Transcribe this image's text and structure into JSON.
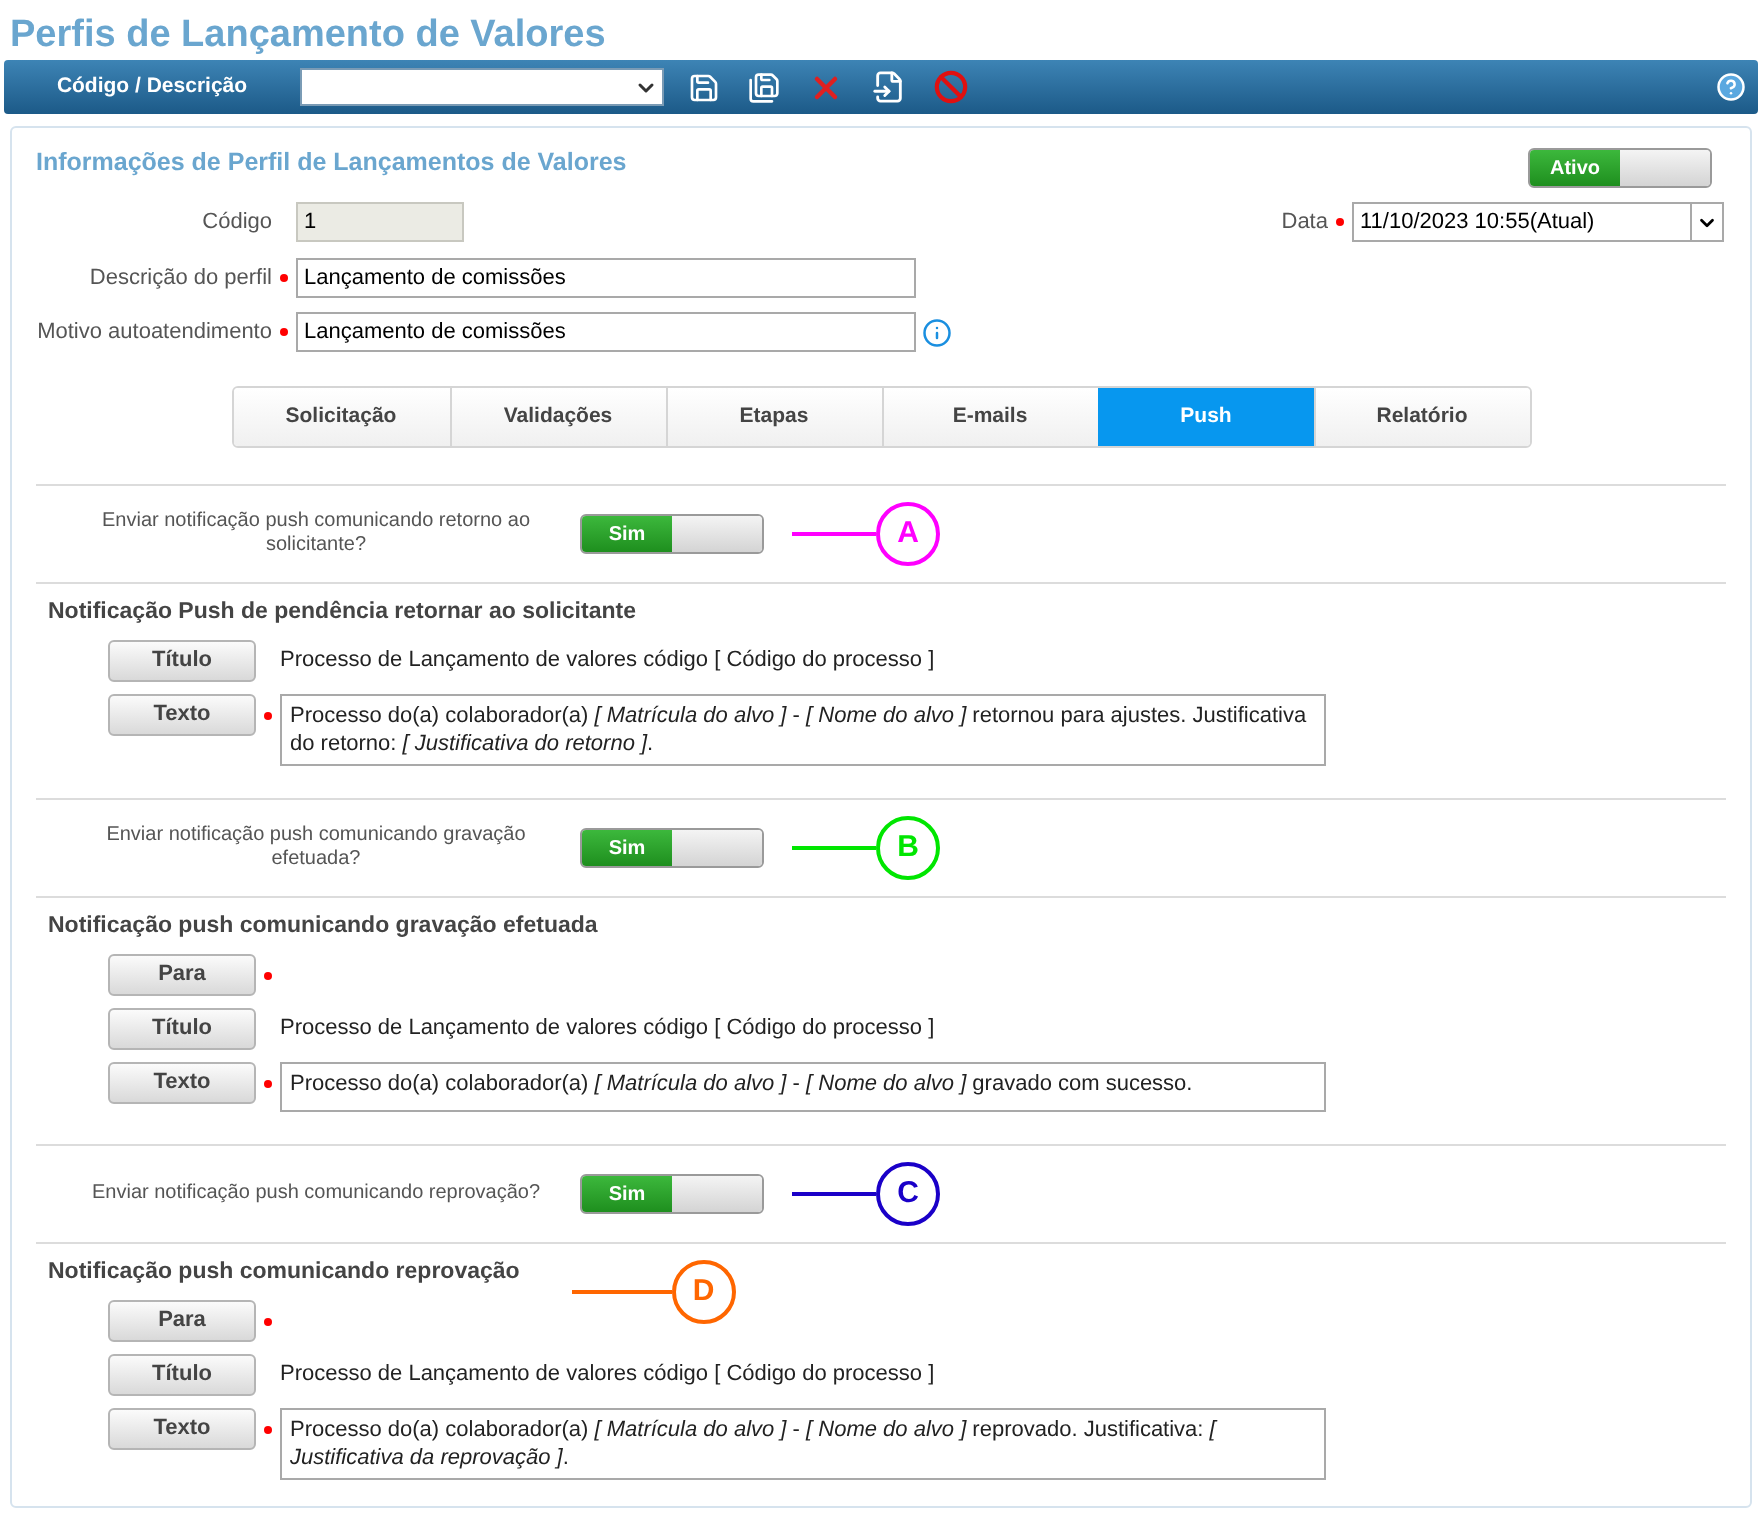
{
  "page_title": "Perfis de Lançamento de Valores",
  "toolbar": {
    "label": "Código / Descrição"
  },
  "panel": {
    "title": "Informações de Perfil de Lançamentos de Valores",
    "status_toggle": {
      "label": "Ativo",
      "on": true
    },
    "fields": {
      "codigo": {
        "label": "Código",
        "value": "1"
      },
      "data": {
        "label": "Data",
        "value": "11/10/2023 10:55(Atual)",
        "required": true
      },
      "descricao": {
        "label": "Descrição do perfil",
        "value": "Lançamento de comissões",
        "required": true
      },
      "motivo": {
        "label": "Motivo autoatendimento",
        "value": "Lançamento de comissões",
        "required": true
      }
    }
  },
  "tabs": [
    {
      "label": "Solicitação",
      "selected": false
    },
    {
      "label": "Validações",
      "selected": false
    },
    {
      "label": "Etapas",
      "selected": false
    },
    {
      "label": "E-mails",
      "selected": false
    },
    {
      "label": "Push",
      "selected": true
    },
    {
      "label": "Relatório",
      "selected": false
    }
  ],
  "sections": [
    {
      "toggle": {
        "label": "Enviar notificação push comunicando retorno ao solicitante?",
        "on": true,
        "text": "Sim"
      },
      "toggle_callout": {
        "letter": "A",
        "color": "#ff00ff"
      },
      "heading": "Notificação Push de pendência retornar ao solicitante",
      "rows": [
        {
          "kind": "text",
          "button": "Título",
          "required": false,
          "value": "Processo de Lançamento de valores código [ Código do processo ]"
        },
        {
          "kind": "box",
          "button": "Texto",
          "required": true,
          "value": "Processo do(a) colaborador(a) *[ Matrícula do alvo ]* - *[ Nome do alvo ]* retornou para ajustes. Justificativa do retorno: *[ Justificativa do retorno ]*."
        }
      ]
    },
    {
      "toggle": {
        "label": "Enviar notificação push comunicando gravação efetuada?",
        "on": true,
        "text": "Sim"
      },
      "toggle_callout": {
        "letter": "B",
        "color": "#00e600"
      },
      "heading": "Notificação push comunicando gravação efetuada",
      "rows": [
        {
          "kind": "empty",
          "button": "Para",
          "required": true
        },
        {
          "kind": "text",
          "button": "Título",
          "required": false,
          "value": "Processo de Lançamento de valores código [ Código do processo ]"
        },
        {
          "kind": "box",
          "button": "Texto",
          "required": true,
          "value": "Processo do(a) colaborador(a) *[ Matrícula do alvo ]* - *[ Nome do alvo ]* gravado com sucesso."
        }
      ]
    },
    {
      "toggle": {
        "label": "Enviar notificação push comunicando reprovação?",
        "on": true,
        "text": "Sim"
      },
      "toggle_callout": {
        "letter": "C",
        "color": "#1a00c8"
      },
      "heading": "Notificação push comunicando reprovação",
      "heading_callout": {
        "letter": "D",
        "color": "#ff6600"
      },
      "rows": [
        {
          "kind": "empty",
          "button": "Para",
          "required": true
        },
        {
          "kind": "text",
          "button": "Título",
          "required": false,
          "value": "Processo de Lançamento de valores código [ Código do processo ]"
        },
        {
          "kind": "box",
          "button": "Texto",
          "required": true,
          "value": "Processo do(a) colaborador(a) *[ Matrícula do alvo ]* - *[ Nome do alvo ]* reprovado. Justificativa: *[ Justificativa da reprovação ]*."
        }
      ]
    }
  ]
}
